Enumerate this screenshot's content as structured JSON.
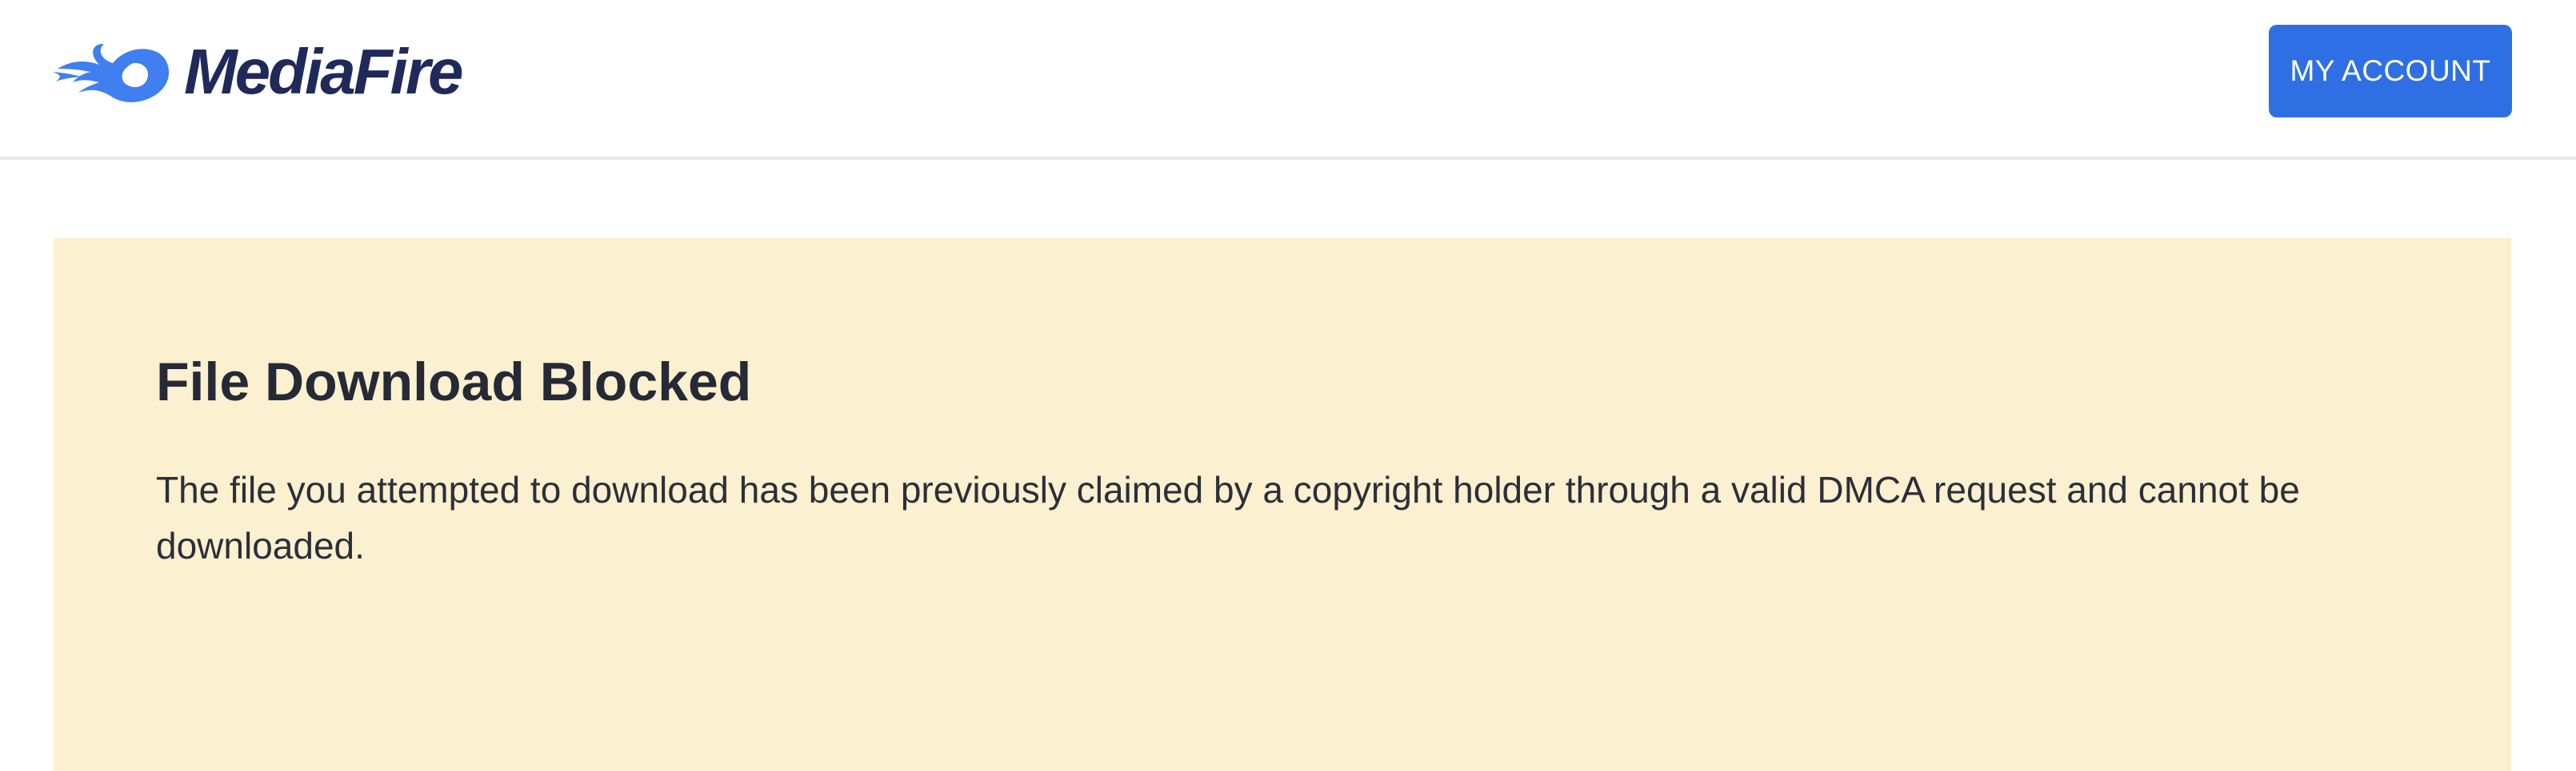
{
  "brand": {
    "name": "MediaFire",
    "icon": "flame-logo-icon",
    "colors": {
      "flame": "#3f7ff0",
      "text": "#1f2a5a"
    }
  },
  "header": {
    "account_button_label": "MY ACCOUNT"
  },
  "notice": {
    "title": "File Download Blocked",
    "message": "The file you attempted to download has been previously claimed by a copyright holder through a valid DMCA request and cannot be downloaded."
  },
  "colors": {
    "accent": "#2f6fe4",
    "notice_background": "#fbf0cf",
    "heading_text": "#262a36",
    "body_text": "#2b2f3a",
    "divider": "#e7e8ea"
  }
}
